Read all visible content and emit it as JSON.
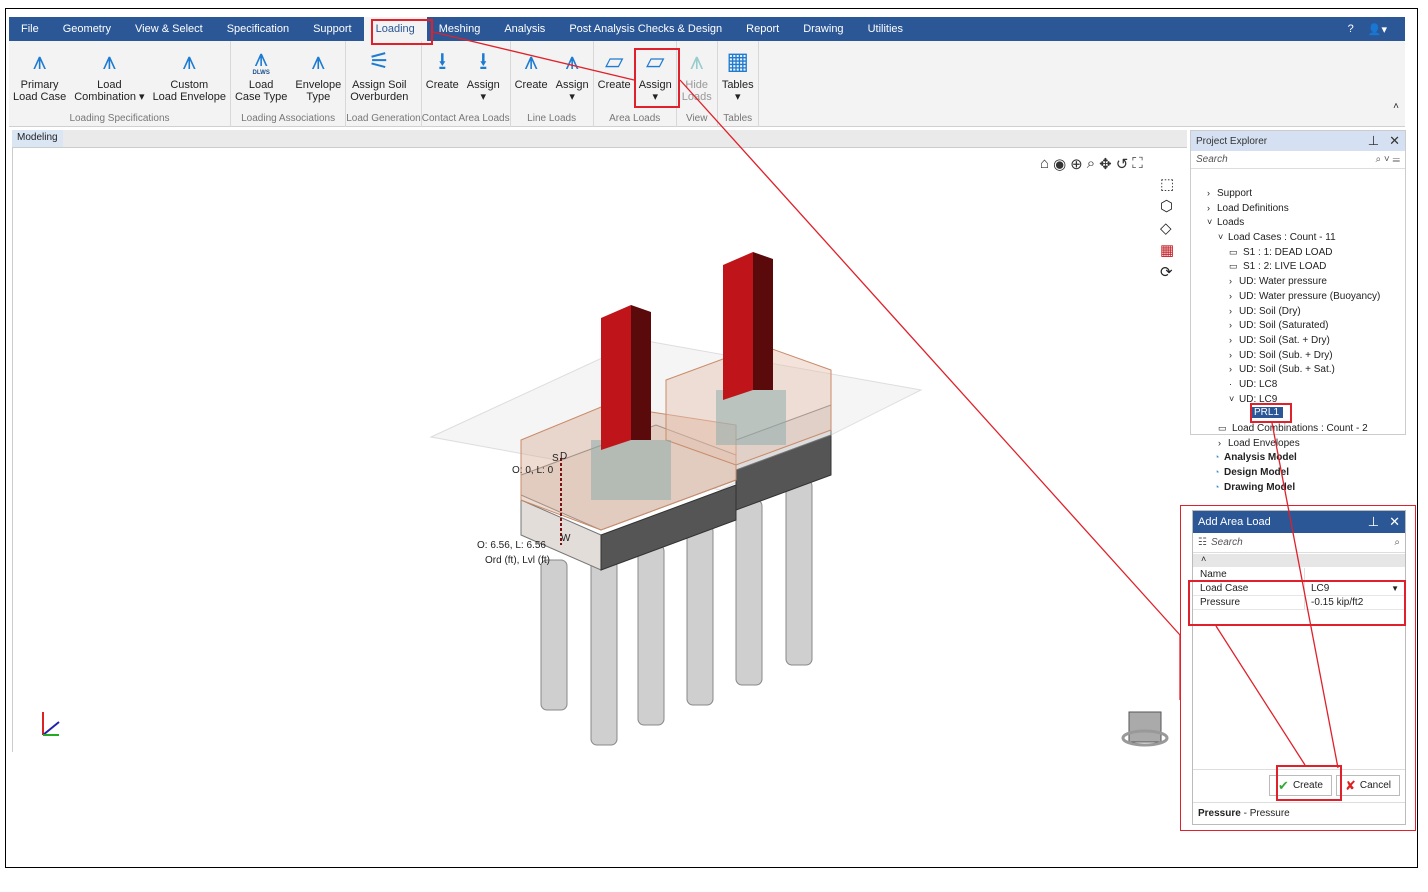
{
  "menu": {
    "items": [
      "File",
      "Geometry",
      "View & Select",
      "Specification",
      "Support",
      "Loading",
      "Meshing",
      "Analysis",
      "Post Analysis Checks & Design",
      "Report",
      "Drawing",
      "Utilities"
    ],
    "active": "Loading"
  },
  "ribbon": {
    "groups": [
      {
        "label": "Loading Specifications",
        "buttons": [
          "Primary\nLoad Case",
          "Load\nCombination ▾",
          "Custom\nLoad Envelope"
        ]
      },
      {
        "label": "Loading Associations",
        "buttons": [
          "Load\nCase Type",
          "Envelope\nType"
        ]
      },
      {
        "label": "Load Generation",
        "buttons": [
          "Assign Soil\nOverburden"
        ]
      },
      {
        "label": "Contact Area Loads",
        "buttons": [
          "Create",
          "Assign\n▾"
        ]
      },
      {
        "label": "Line Loads",
        "buttons": [
          "Create",
          "Assign\n▾"
        ]
      },
      {
        "label": "Area Loads",
        "buttons": [
          "Create",
          "Assign\n▾"
        ]
      },
      {
        "label": "View",
        "buttons": [
          "Hide\nLoads"
        ]
      },
      {
        "label": "Tables",
        "buttons": [
          "Tables\n▾"
        ]
      }
    ],
    "dlws": "DLWS"
  },
  "tabs": {
    "modeling": "Modeling"
  },
  "viewport": {
    "label_top": "O: 0, L: 0",
    "label_bottom": "O:  6.56, L:  6.56",
    "label_units": "Ord (ft), Lvl (ft)",
    "marker_s": "S",
    "marker_d": "D",
    "marker_w": "W"
  },
  "project_explorer": {
    "title": "Project Explorer",
    "search_placeholder": "Search",
    "tree": [
      {
        "label": "Support",
        "level": 1,
        "icon": ">"
      },
      {
        "label": "Load Definitions",
        "level": 1,
        "icon": ">"
      },
      {
        "label": "Loads",
        "level": 1,
        "icon": "v"
      },
      {
        "label": "Load Cases : Count - 11",
        "level": 2,
        "icon": "v"
      },
      {
        "label": "S1 : 1: DEAD LOAD",
        "level": 3,
        "icon": "box"
      },
      {
        "label": "S1 : 2: LIVE LOAD",
        "level": 3,
        "icon": "box"
      },
      {
        "label": "UD: Water pressure",
        "level": 3,
        "icon": ">"
      },
      {
        "label": "UD: Water pressure (Buoyancy)",
        "level": 3,
        "icon": ">"
      },
      {
        "label": "UD: Soil (Dry)",
        "level": 3,
        "icon": ">"
      },
      {
        "label": "UD: Soil (Saturated)",
        "level": 3,
        "icon": ">"
      },
      {
        "label": "UD: Soil (Sat. + Dry)",
        "level": 3,
        "icon": ">"
      },
      {
        "label": "UD: Soil (Sub. + Dry)",
        "level": 3,
        "icon": ">"
      },
      {
        "label": "UD: Soil (Sub. + Sat.)",
        "level": 3,
        "icon": ">"
      },
      {
        "label": "UD: LC8",
        "level": 3,
        "icon": "-"
      },
      {
        "label": "UD: LC9",
        "level": 3,
        "icon": "v"
      },
      {
        "label": "PRL1",
        "level": 4,
        "icon": "sel"
      },
      {
        "label": "Load Combinations : Count - 2",
        "level": 2,
        "icon": "box"
      },
      {
        "label": "Load Envelopes",
        "level": 2,
        "icon": ">"
      },
      {
        "label": "Analysis Model",
        "level": 0,
        "icon": "model"
      },
      {
        "label": "Design Model",
        "level": 0,
        "icon": "model"
      },
      {
        "label": "Drawing Model",
        "level": 0,
        "icon": "model"
      }
    ]
  },
  "add_area_load": {
    "title": "Add Area Load",
    "search_placeholder": "Search",
    "properties": [
      {
        "name": "Name",
        "value": ""
      },
      {
        "name": "Load Case",
        "value": "LC9"
      },
      {
        "name": "Pressure",
        "value": "-0.15 kip/ft2"
      }
    ],
    "create_label": "Create",
    "cancel_label": "Cancel",
    "status_bold": "Pressure",
    "status_text": " - Pressure"
  },
  "colors": {
    "accent": "#2b5797",
    "annotation": "#e0202a",
    "column": "#c0141b"
  }
}
